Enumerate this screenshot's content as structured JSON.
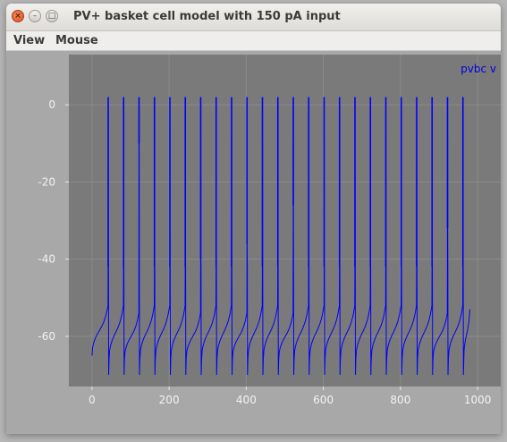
{
  "window": {
    "title": "PV+ basket cell model with 150 pA input",
    "close_glyph": "×",
    "minimize_glyph": "–",
    "maximize_glyph": "□"
  },
  "menubar": {
    "items": [
      {
        "label": "View"
      },
      {
        "label": "Mouse"
      }
    ]
  },
  "colors": {
    "plot_background": "#7a7a7a",
    "outer_background": "#a8a8a8",
    "trace": "#0000ff",
    "grid": "#8a8a8a"
  },
  "chart_data": {
    "type": "line",
    "title": "",
    "xlabel": "",
    "ylabel": "",
    "xlim": [
      -60,
      1060
    ],
    "ylim": [
      -73,
      13
    ],
    "x_ticks": [
      0,
      200,
      400,
      600,
      800,
      1000
    ],
    "x_tick_labels": [
      "0",
      "200",
      "400",
      "600",
      "800",
      "1000"
    ],
    "y_ticks": [
      0,
      -20,
      -40,
      -60
    ],
    "y_tick_labels": [
      "0",
      "-20",
      "-40",
      "-60"
    ],
    "grid": true,
    "legend_position": "top-right",
    "series": [
      {
        "name": "pvbc v",
        "color": "#0000ff",
        "start": {
          "x": 0,
          "y": -65
        },
        "end": {
          "x": 980,
          "y": -53
        },
        "reset_level": -70,
        "spike_peak": 2,
        "spikes": [
          {
            "x": 42,
            "threshold": -42
          },
          {
            "x": 82,
            "threshold": -42
          },
          {
            "x": 122,
            "threshold": -10
          },
          {
            "x": 162,
            "threshold": -42
          },
          {
            "x": 202,
            "threshold": -42
          },
          {
            "x": 242,
            "threshold": -42
          },
          {
            "x": 282,
            "threshold": -40
          },
          {
            "x": 322,
            "threshold": -42
          },
          {
            "x": 362,
            "threshold": -42
          },
          {
            "x": 402,
            "threshold": -36
          },
          {
            "x": 442,
            "threshold": -42
          },
          {
            "x": 482,
            "threshold": -42
          },
          {
            "x": 522,
            "threshold": -26
          },
          {
            "x": 562,
            "threshold": -42
          },
          {
            "x": 602,
            "threshold": -42
          },
          {
            "x": 642,
            "threshold": -42
          },
          {
            "x": 682,
            "threshold": -42
          },
          {
            "x": 722,
            "threshold": -42
          },
          {
            "x": 762,
            "threshold": -42
          },
          {
            "x": 802,
            "threshold": -42
          },
          {
            "x": 842,
            "threshold": -42
          },
          {
            "x": 882,
            "threshold": -42
          },
          {
            "x": 922,
            "threshold": -32
          },
          {
            "x": 962,
            "threshold": -42
          }
        ]
      }
    ]
  }
}
